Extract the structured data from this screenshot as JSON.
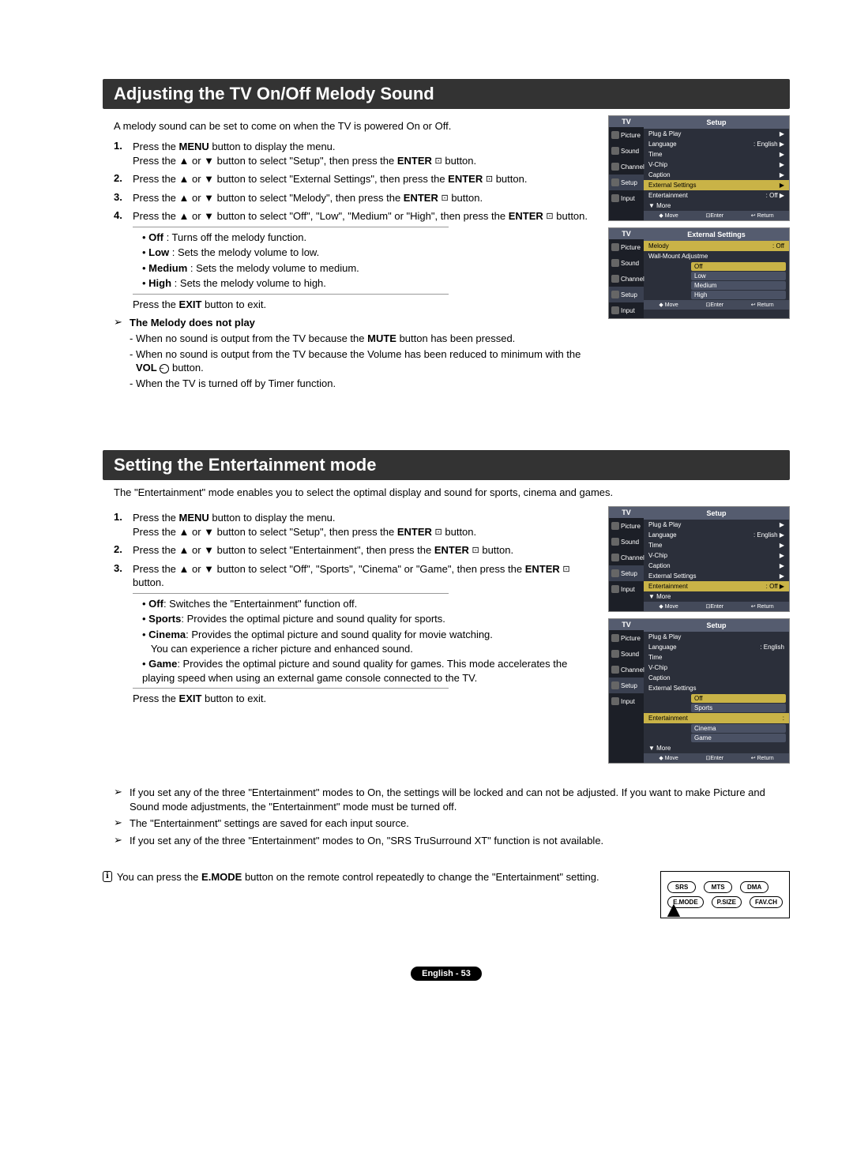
{
  "section1": {
    "title": "Adjusting the TV On/Off Melody Sound",
    "intro": "A melody sound can be set to come on when the TV is powered On or Off.",
    "step1a": "Press the ",
    "step1a_b": "MENU",
    "step1a2": " button to display the menu.",
    "step1b": "Press the ▲ or ▼ button to select \"Setup\", then press the ",
    "step1b_b": "ENTER",
    "step1b2": " button.",
    "step2": "Press the ▲ or ▼ button to select \"External Settings\", then press the ",
    "step2_b": "ENTER",
    "step2_2": " button.",
    "step3": "Press the ▲ or ▼ button to select \"Melody\", then press the ",
    "step3_b": "ENTER",
    "step3_2": " button.",
    "step4a": "Press the ▲ or ▼ button to select \"Off\", \"Low\", \"Medium\" or \"High\", then press the ",
    "step4a_b": "ENTER",
    "step4a2": " button.",
    "opt_off_b": "Off",
    "opt_off": " : Turns off the melody function.",
    "opt_low_b": "Low",
    "opt_low": " : Sets the melody volume to low.",
    "opt_med_b": "Medium",
    "opt_med": " : Sets the melody volume to medium.",
    "opt_high_b": "High",
    "opt_high": " : Sets the melody volume to high.",
    "step4b": "Press the ",
    "step4b_b": "EXIT",
    "step4b2": " button to exit.",
    "note_title": "The Melody does not play",
    "note1": "- When no sound is output from the TV because the ",
    "note1_b": "MUTE",
    "note1_2": " button has been pressed.",
    "note2": "- When no sound is output from the TV because the Volume has been reduced to minimum with the ",
    "note2_b": "VOL",
    "note2_2": " button.",
    "note3": "- When the TV is turned off by Timer function.",
    "vol_minus": "–"
  },
  "section2": {
    "title": "Setting the Entertainment mode",
    "intro": "The \"Entertainment\" mode enables you to select the optimal display and sound for sports, cinema and games.",
    "step1a": "Press the ",
    "step1a_b": "MENU",
    "step1a2": " button to display the menu.",
    "step1b": "Press the ▲ or ▼ button to select \"Setup\", then press the ",
    "step1b_b": "ENTER",
    "step1b2": " button.",
    "step2": "Press the ▲ or ▼ button to select \"Entertainment\", then press the ",
    "step2_b": "ENTER",
    "step2_2": " button.",
    "step3a": "Press the ▲ or ▼ button to select \"Off\", \"Sports\", \"Cinema\" or \"Game\", then press the ",
    "step3a_b": "ENTER",
    "step3a2": " button.",
    "opt_off_b": "Off",
    "opt_off": ": Switches the \"Entertainment\" function off.",
    "opt_sports_b": "Sports",
    "opt_sports": ": Provides the optimal picture and sound quality for sports.",
    "opt_cinema_b": "Cinema",
    "opt_cinema": ": Provides the optimal picture and sound quality for movie watching.",
    "opt_cinema2": "You can experience a richer picture and enhanced sound.",
    "opt_game_b": "Game",
    "opt_game": ": Provides the optimal picture and sound quality for games. This mode accelerates the playing speed when using an external game console connected to the TV.",
    "step3b": "Press the ",
    "step3b_b": "EXIT",
    "step3b2": " button to exit.",
    "note1": "If you set any of the three \"Entertainment\" modes to On, the settings will be locked and can not be adjusted. If you want to make Picture and Sound mode adjustments, the \"Entertainment\" mode must be turned off.",
    "note2": "The \"Entertainment\" settings are saved for each input source.",
    "note3": "If you set any of the three \"Entertainment\" modes to On, \"SRS TruSurround XT\" function is not available.",
    "remote_note1": "You can press the ",
    "remote_note_b": "E.MODE",
    "remote_note2": " button on the remote control repeatedly to change the \"Entertainment\" setting."
  },
  "osd": {
    "tv": "TV",
    "setup": "Setup",
    "ext_settings": "External Settings",
    "side_picture": "Picture",
    "side_sound": "Sound",
    "side_channel": "Channel",
    "side_setup": "Setup",
    "side_input": "Input",
    "plug_play": "Plug & Play",
    "language": "Language",
    "lang_val": ": English",
    "time": "Time",
    "vchip": "V-Chip",
    "caption": "Caption",
    "external": "External Settings",
    "entertainment": "Entertainment",
    "ent_val": ": Off",
    "more": "▼ More",
    "move": "Move",
    "enter": "Enter",
    "return": "Return",
    "melody": "Melody",
    "wall": "Wall-Mount Adjustme",
    "off": "Off",
    "low": "Low",
    "medium": "Medium",
    "high": "High",
    "sports": "Sports",
    "cinema": "Cinema",
    "game": "Game",
    "updown": "◆"
  },
  "remote": {
    "srs": "SRS",
    "mts": "MTS",
    "dma": "DMA",
    "emode": "E.MODE",
    "psize": "P.SIZE",
    "favch": "FAV.CH"
  },
  "nums": {
    "n1": "1.",
    "n2": "2.",
    "n3": "3.",
    "n4": "4."
  },
  "icons": {
    "note": "➢",
    "info": "ℹ",
    "enter_sym": "⊡"
  },
  "footer": "English - 53"
}
